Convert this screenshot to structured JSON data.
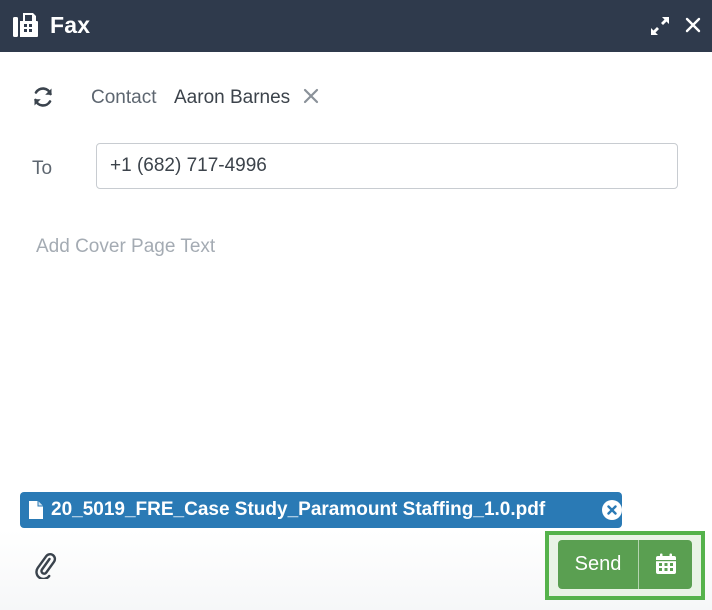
{
  "window": {
    "title": "Fax",
    "icon": "fax-icon",
    "header_color": "#2f3a4c"
  },
  "contact": {
    "label": "Contact",
    "name": "Aaron Barnes"
  },
  "to": {
    "label": "To",
    "value": "+1 (682) 717-4996"
  },
  "cover_page": {
    "placeholder": "Add Cover Page Text",
    "value": ""
  },
  "attachment": {
    "file_name": "20_5019_FRE_Case Study_Paramount Staffing_1.0.pdf",
    "color": "#2a7ab5"
  },
  "footer": {
    "send_label": "Send",
    "send_color": "#5a9f51",
    "highlight_color": "#55b24b"
  }
}
